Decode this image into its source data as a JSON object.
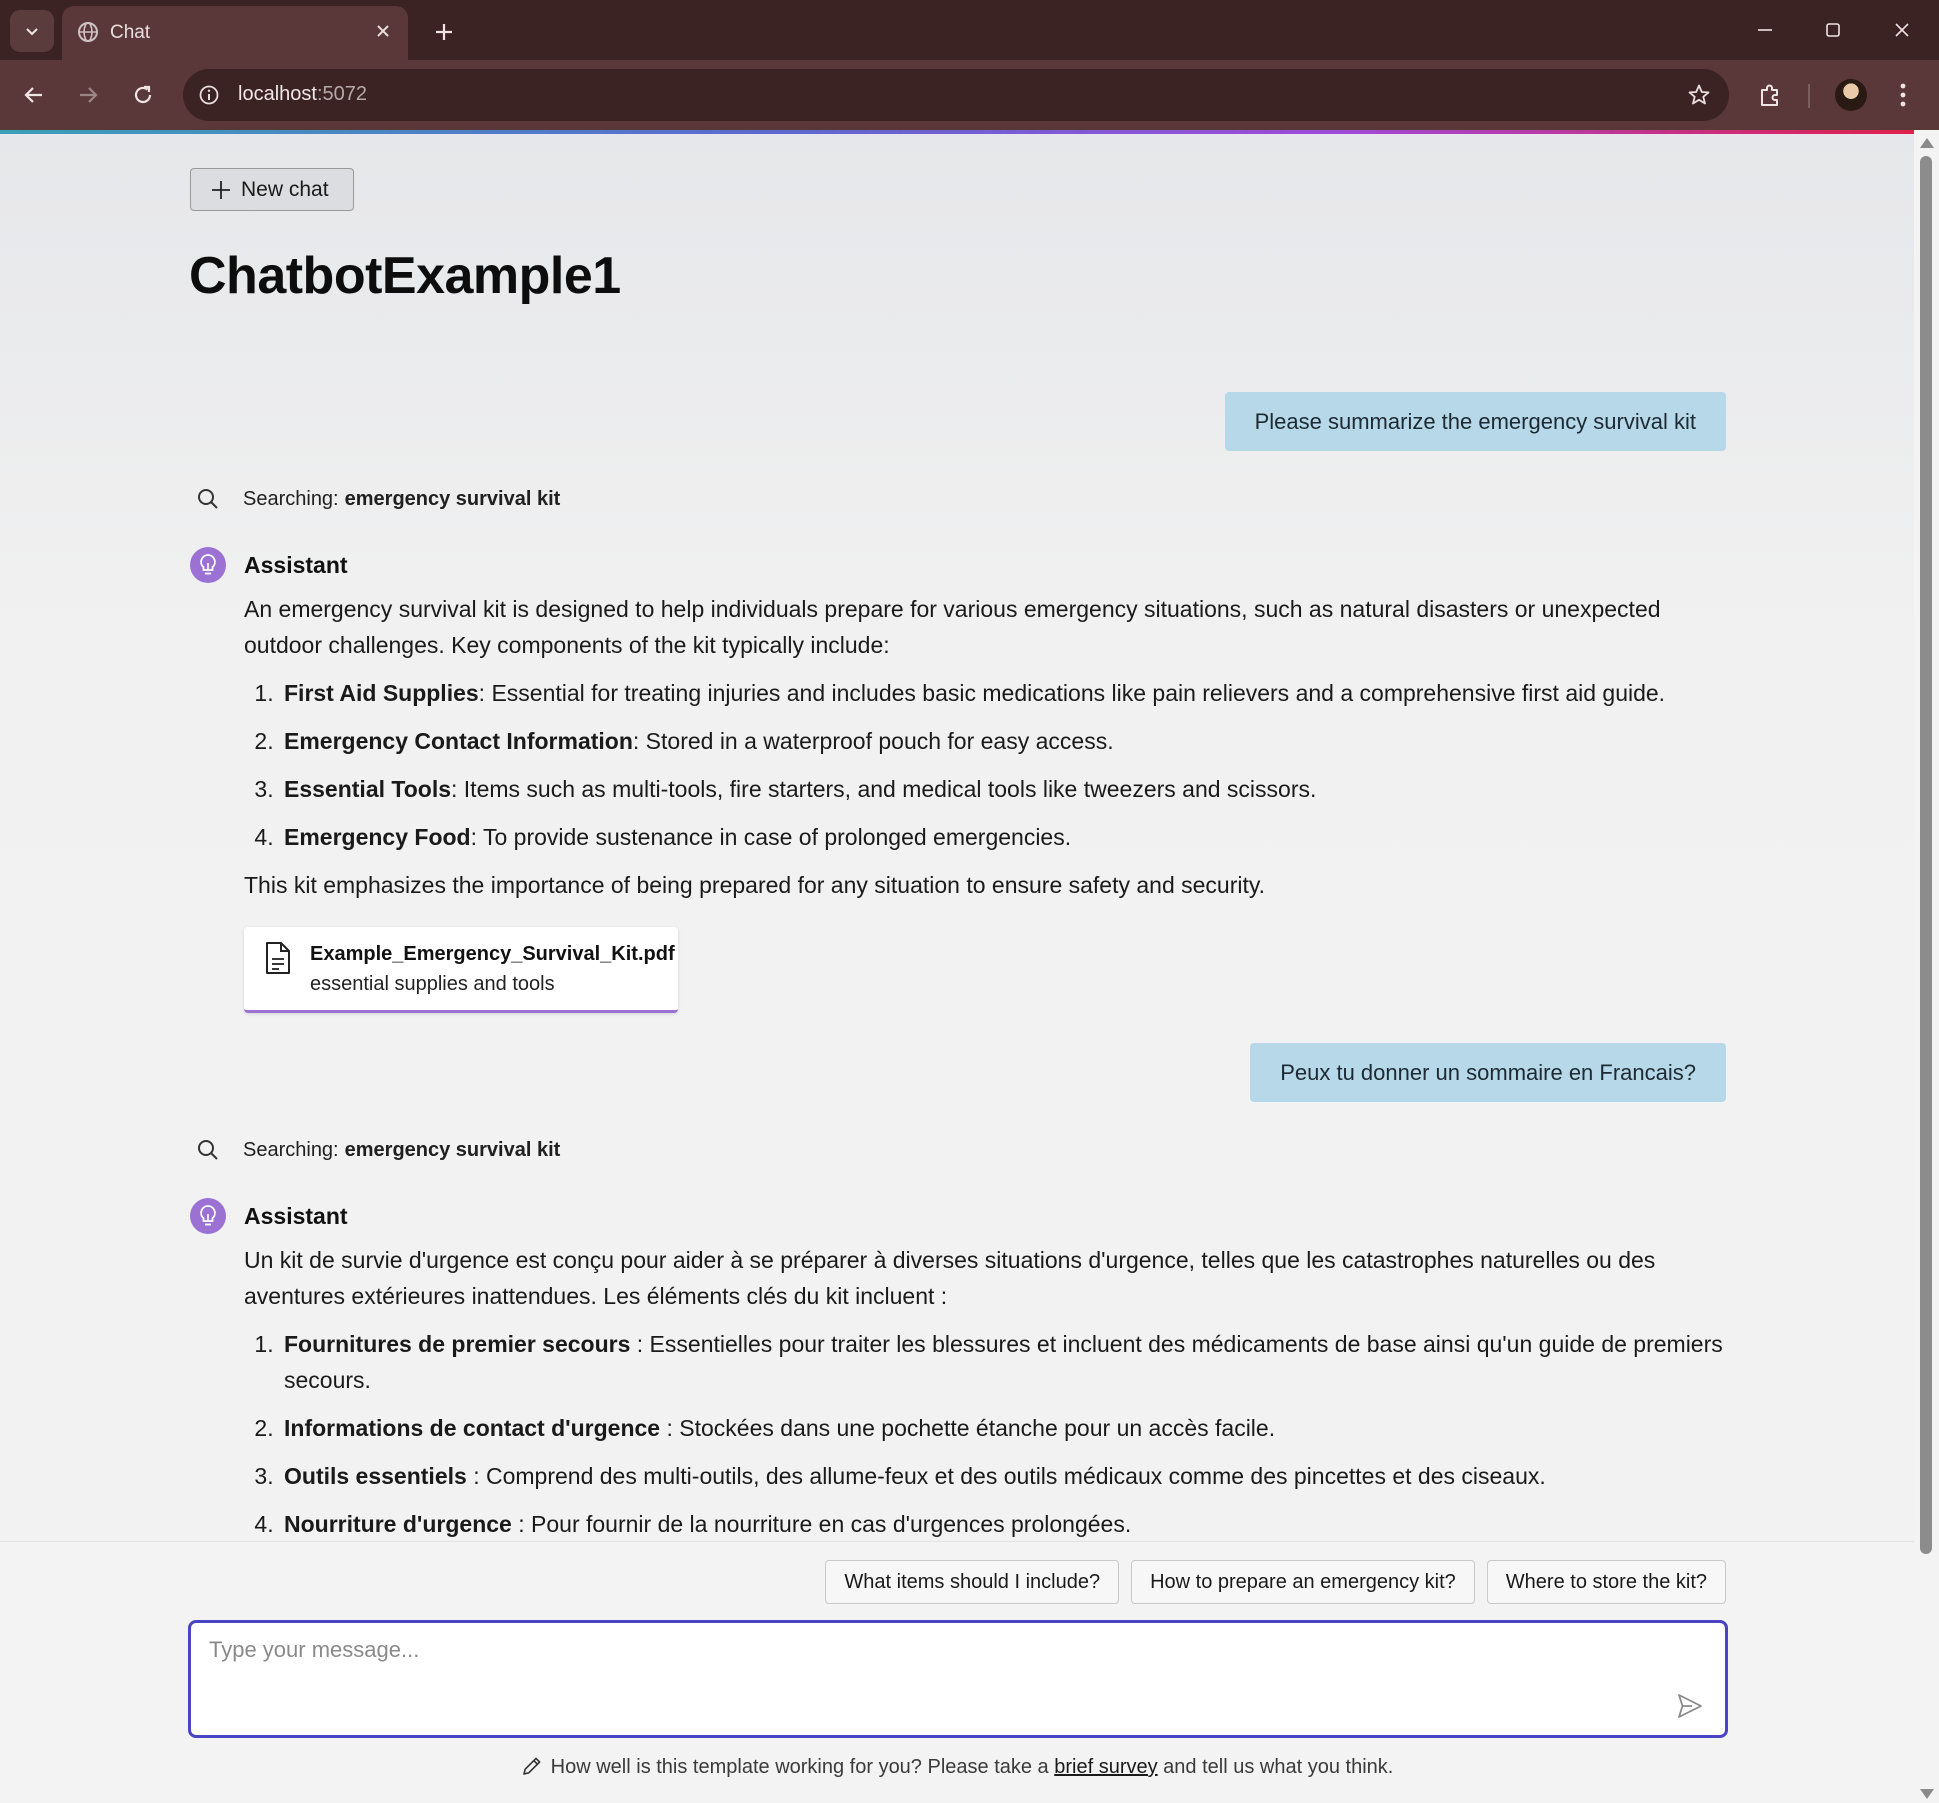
{
  "browser": {
    "tab_title": "Chat",
    "url_host": "localhost",
    "url_port": ":5072"
  },
  "page": {
    "new_chat_label": "New chat",
    "title": "ChatbotExample1"
  },
  "conversation": [
    {
      "role": "user",
      "text": "Please summarize the emergency survival kit"
    },
    {
      "role": "search",
      "label": "Searching:",
      "query": "emergency survival kit"
    },
    {
      "role": "assistant",
      "name": "Assistant",
      "intro": "An emergency survival kit is designed to help individuals prepare for various emergency situations, such as natural disasters or unexpected outdoor challenges. Key components of the kit typically include:",
      "items": [
        {
          "term": "First Aid Supplies",
          "text": ": Essential for treating injuries and includes basic medications like pain relievers and a comprehensive first aid guide."
        },
        {
          "term": "Emergency Contact Information",
          "text": ": Stored in a waterproof pouch for easy access."
        },
        {
          "term": "Essential Tools",
          "text": ": Items such as multi-tools, fire starters, and medical tools like tweezers and scissors."
        },
        {
          "term": "Emergency Food",
          "text": ": To provide sustenance in case of prolonged emergencies."
        }
      ],
      "closing": "This kit emphasizes the importance of being prepared for any situation to ensure safety and security.",
      "citation": {
        "file": "Example_Emergency_Survival_Kit.pdf",
        "desc": "essential supplies and tools"
      }
    },
    {
      "role": "user",
      "text": "Peux tu donner un sommaire en Francais?"
    },
    {
      "role": "search",
      "label": "Searching:",
      "query": "emergency survival kit"
    },
    {
      "role": "assistant",
      "name": "Assistant",
      "intro": "Un kit de survie d'urgence est conçu pour aider à se préparer à diverses situations d'urgence, telles que les catastrophes naturelles ou des aventures extérieures inattendues. Les éléments clés du kit incluent :",
      "items": [
        {
          "term": "Fournitures de premier secours",
          "text": " : Essentielles pour traiter les blessures et incluent des médicaments de base ainsi qu'un guide de premiers secours."
        },
        {
          "term": "Informations de contact d'urgence",
          "text": " : Stockées dans une pochette étanche pour un accès facile."
        },
        {
          "term": "Outils essentiels",
          "text": " : Comprend des multi-outils, des allume-feux et des outils médicaux comme des pincettes et des ciseaux."
        },
        {
          "term": "Nourriture d'urgence",
          "text": " : Pour fournir de la nourriture en cas d'urgences prolongées."
        }
      ]
    }
  ],
  "suggestions": [
    "What items should I include?",
    "How to prepare an emergency kit?",
    "Where to store the kit?"
  ],
  "composer": {
    "placeholder": "Type your message..."
  },
  "survey": {
    "before": "How well is this template working for you? Please take a ",
    "link": "brief survey",
    "after": " and tell us what you think."
  },
  "colors": {
    "user_bubble": "#b7d8e8",
    "assistant_accent": "#9b72d4",
    "composer_border": "#4a43c4",
    "chrome_dark": "#3b2223",
    "chrome_mid": "#5a3839"
  }
}
